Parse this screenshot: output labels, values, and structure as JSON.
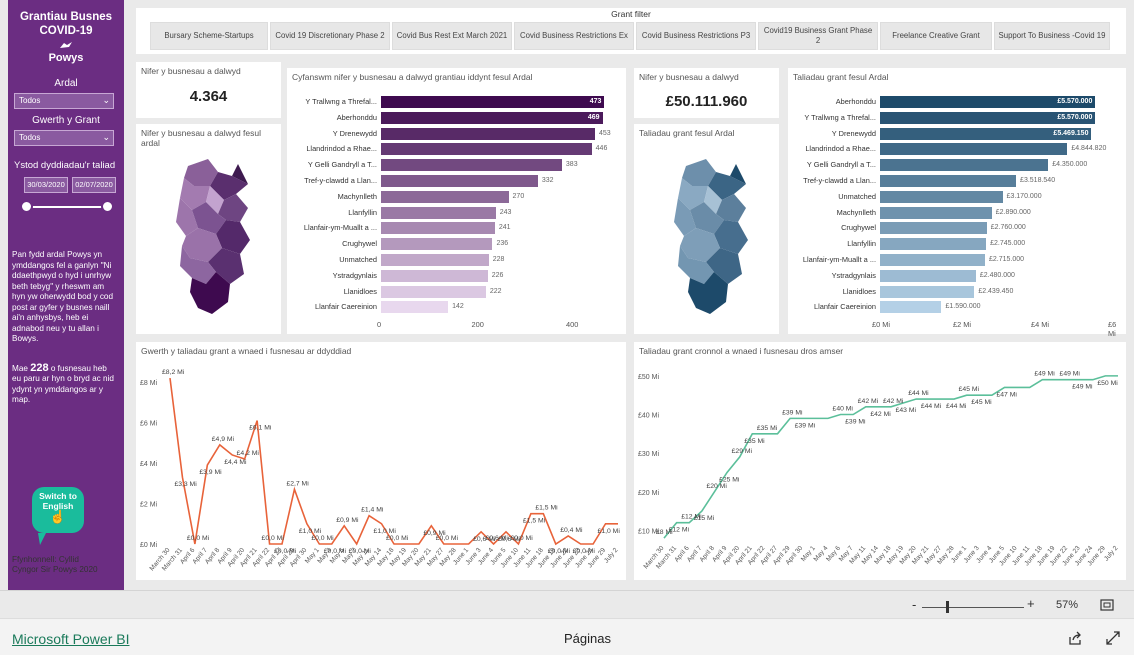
{
  "sidebar": {
    "title_line1": "Grantiau Busnes",
    "title_line2": "COVID-19",
    "logo_text": "Powys",
    "area_label": "Ardal",
    "area_value": "Todos",
    "grant_type_label": "Gwerth y Grant",
    "grant_type_value": "Todos",
    "date_label": "Ystod dyddiadau'r taliad",
    "date_start": "30/03/2020",
    "date_end": "02/07/2020",
    "note1": "Pan fydd ardal Powys yn ymddangos fel a ganlyn \"Ni ddaethpwyd o hyd i unrhyw beth tebyg\" y rheswm am hyn yw oherwydd bod y cod post ar gyfer y busnes naill ai'n anhysbys, heb ei adnabod neu y tu allan i Bowys.",
    "note2_prefix": "Mae ",
    "note2_count": "228",
    "note2_suffix": " o fusnesau heb eu paru ar hyn o bryd ac nid ydynt yn ymddangos ar y map.",
    "switch_line1": "Switch to",
    "switch_line2": "English",
    "footer_line1": "Ffynhonnell:  Cyllid",
    "footer_line2": "Cyngor Sir Powys 2020"
  },
  "filter": {
    "title": "Grant filter",
    "buttons": [
      "Bursary Scheme-Startups",
      "Covid 19 Discretionary Phase 2",
      "Covid Bus Rest Ext March 2021",
      "Covid Business Restrictions Ex",
      "Covid Business Restrictions P3",
      "Covid19 Business Grant Phase 2",
      "Freelance Creative Grant",
      "Support To Business -Covid 19"
    ]
  },
  "kpi_count": {
    "title": "Nifer y busnesau a dalwyd",
    "value": "4.364"
  },
  "kpi_amount": {
    "title": "Nifer y busnesau a dalwyd",
    "value": "£50.111.960"
  },
  "map_count": {
    "title": "Nifer y busnesau a dalwyd fesul ardal"
  },
  "map_amount": {
    "title": "Taliadau grant fesul Ardal"
  },
  "bar_count": {
    "title": "Cyfanswm nifer y busnesau a dalwyd grantiau iddynt fesul Ardal",
    "ticks": [
      "0",
      "200",
      "400"
    ]
  },
  "bar_amount": {
    "title": "Taliadau grant fesul Ardal",
    "ticks": [
      "£0 Mi",
      "£2 Mi",
      "£4 Mi",
      "£6 Mi"
    ]
  },
  "line_daily": {
    "title": "Gwerth y taliadau grant a wnaed i fusnesau ar ddyddiad",
    "yticks": [
      "£0 Mi",
      "£2 Mi",
      "£4 Mi",
      "£6 Mi",
      "£8 Mi"
    ]
  },
  "line_cum": {
    "title": "Taliadau grant cronnol a wnaed i fusnesau dros amser",
    "yticks": [
      "£10 Mi",
      "£20 Mi",
      "£30 Mi",
      "£40 Mi",
      "£50 Mi"
    ]
  },
  "chart_data": [
    {
      "type": "bar",
      "title": "Cyfanswm nifer y busnesau a dalwyd grantiau iddynt fesul Ardal",
      "categories": [
        "Y Trallwng a Threfal...",
        "Aberhonddu",
        "Y Drenewydd",
        "Llandrindod a Rhae...",
        "Y Gelli Gandryll a T...",
        "Tref-y-clawdd a Llan...",
        "Machynlleth",
        "Llanfyllin",
        "Llanfair-ym-Muallt a ...",
        "Crughywel",
        "Unmatched",
        "Ystradgynlais",
        "Llanidloes",
        "Llanfair Caereinion"
      ],
      "values": [
        473,
        469,
        453,
        446,
        383,
        332,
        270,
        243,
        241,
        236,
        228,
        226,
        222,
        142
      ],
      "xlim": [
        0,
        470
      ]
    },
    {
      "type": "bar",
      "title": "Taliadau grant fesul Ardal",
      "categories": [
        "Aberhonddu",
        "Y Trallwng a Threfal...",
        "Y Drenewydd",
        "Llandrindod a Rhae...",
        "Y Gelli Gandryll a T...",
        "Tref-y-clawdd a Llan...",
        "Unmatched",
        "Machynlleth",
        "Crughywel",
        "Llanfyllin",
        "Llanfair-ym-Muallt a ...",
        "Ystradgynlais",
        "Llanidloes",
        "Llanfair Caereinion"
      ],
      "values": [
        5570000,
        5570000,
        5469150,
        4844820,
        4350000,
        3518540,
        3170000,
        2890000,
        2760000,
        2745000,
        2715000,
        2480000,
        2439450,
        1590000
      ],
      "labels": [
        "£5.570.000",
        "£5.570.000",
        "£5.469.150",
        "£4.844.820",
        "£4.350.000",
        "£3.518.540",
        "£3.170.000",
        "£2.890.000",
        "£2.760.000",
        "£2.745.000",
        "£2.715.000",
        "£2.480.000",
        "£2.439.450",
        "£1.590.000"
      ],
      "xlim": [
        0,
        6000000
      ]
    },
    {
      "type": "line",
      "title": "Gwerth y taliadau grant a wnaed i fusnesau ar ddyddiad",
      "x": [
        "March 30",
        "March 31",
        "April 6",
        "April 7",
        "April 8",
        "April 9",
        "April 20",
        "April 21",
        "April 22",
        "April 27",
        "April 29",
        "April 30",
        "May 1",
        "May 4",
        "May 6",
        "May 7",
        "May 11",
        "May 14",
        "May 18",
        "May 19",
        "May 20",
        "May 21",
        "May 27",
        "May 28",
        "June 1",
        "June 3",
        "June 4",
        "June 5",
        "June 10",
        "June 11",
        "June 18",
        "June 19",
        "June 22",
        "June 23",
        "June 24",
        "June 29",
        "July 2"
      ],
      "y": [
        8.2,
        3.3,
        0.0,
        3.9,
        4.9,
        4.4,
        4.2,
        6.1,
        0.0,
        0.0,
        2.7,
        1.0,
        0.0,
        0.0,
        0.9,
        0.0,
        1.4,
        1.0,
        0.0,
        0.0,
        0.0,
        0.9,
        0.0,
        0.0,
        0.0,
        0.6,
        0.0,
        0.6,
        0.0,
        1.5,
        1.5,
        0.0,
        0.4,
        0.0,
        0.0,
        1.0,
        1.0
      ],
      "labels": [
        "£8,2 Mi",
        "£3,3 Mi",
        "£0,0 Mi",
        "£3,9 Mi",
        "£4,9 Mi",
        "£4,4 Mi",
        "£4,2 Mi",
        "£6,1 Mi",
        "£0,0 Mi",
        "£0,0 Mi",
        "£2,7 Mi",
        "£1,0 Mi",
        "£0,0 Mi",
        "£0,0 Mi",
        "£0,9 Mi",
        "£0,0 Mi",
        "£1,4 Mi",
        "£1,0 Mi",
        "£0,0 Mi",
        "",
        "",
        "£0,9 Mi",
        "£0,0 Mi",
        "",
        "",
        "£0,6 Mi",
        "£0,6 Mi",
        "£0,6 Mi",
        "£0,0 Mi",
        "£1,5 Mi",
        "£1,5 Mi",
        "£0,0 Mi",
        "£0,4 Mi",
        "£0,0 Mi",
        "",
        "£1,0 Mi",
        ""
      ],
      "ylim": [
        0,
        8.5
      ],
      "ylabel_unit": "Mi",
      "color": "#e8633a"
    },
    {
      "type": "line",
      "title": "Taliadau grant cronnol a wnaed i fusnesau dros amser",
      "x": [
        "March 30",
        "March 31",
        "April 6",
        "April 7",
        "April 8",
        "April 9",
        "April 20",
        "April 21",
        "April 22",
        "April 27",
        "April 29",
        "April 30",
        "May 1",
        "May 4",
        "May 6",
        "May 7",
        "May 11",
        "May 14",
        "May 18",
        "May 19",
        "May 20",
        "May 21",
        "May 27",
        "May 28",
        "June 1",
        "June 3",
        "June 4",
        "June 5",
        "June 10",
        "June 11",
        "June 18",
        "June 19",
        "June 22",
        "June 23",
        "June 24",
        "June 29",
        "July 2"
      ],
      "y": [
        8,
        12,
        12,
        15,
        20,
        25,
        29,
        35,
        35,
        35,
        39,
        39,
        39,
        39,
        40,
        40,
        42,
        42,
        42,
        43,
        44,
        44,
        44,
        44,
        45,
        45,
        45,
        47,
        47,
        47,
        49,
        49,
        49,
        49,
        49,
        50,
        50
      ],
      "labels": [
        "£8 Mi",
        "£12 Mi",
        "£12 Mi",
        "£15 Mi",
        "£20 Mi",
        "£25 Mi",
        "£29 Mi",
        "£35 Mi",
        "£35 Mi",
        "",
        "£39 Mi",
        "£39 Mi",
        "",
        "",
        "£40 Mi",
        "£39 Mi",
        "£42 Mi",
        "£42 Mi",
        "£42 Mi",
        "£43 Mi",
        "£44 Mi",
        "£44 Mi",
        "",
        "£44 Mi",
        "£45 Mi",
        "£45 Mi",
        "",
        "£47 Mi",
        "",
        "",
        "£49 Mi",
        "",
        "£49 Mi",
        "£49 Mi",
        "",
        "£50 Mi",
        ""
      ],
      "ylim": [
        7,
        51
      ],
      "ylabel_unit": "Mi",
      "color": "#5bbf9a"
    }
  ],
  "colors": {
    "sidebar": "#6b2d82",
    "count_bars_dark": "#3e0a4f",
    "amount_bars_dark": "#1d4a6a",
    "daily_line": "#e8633a",
    "cum_line": "#5bbf9a"
  },
  "zoom": {
    "minus": "-",
    "plus": "+",
    "level": "57%"
  },
  "bottom": {
    "link": "Microsoft Power BI",
    "pages": "Páginas"
  }
}
